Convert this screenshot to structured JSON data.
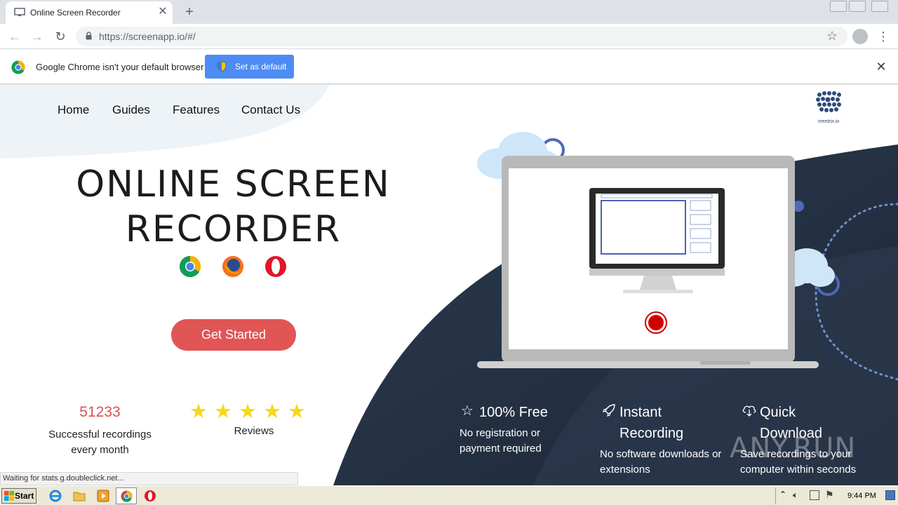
{
  "browser": {
    "tab_title": "Online Screen Recorder",
    "url": "https://screenapp.io/#/",
    "infobar_text": "Google Chrome isn't your default browser",
    "infobar_button": "Set as default"
  },
  "nav": {
    "items": [
      "Home",
      "Guides",
      "Features",
      "Contact Us"
    ],
    "logo_text": "meetrix.io"
  },
  "hero": {
    "title_line1": "ONLINE SCREEN",
    "title_line2": "RECORDER",
    "browsers": [
      "chrome-icon",
      "firefox-icon",
      "opera-icon"
    ],
    "cta": "Get Started"
  },
  "stats": {
    "count": "51233",
    "count_label": "Successful recordings every month",
    "stars": "★★★★★",
    "rating": 5,
    "reviews_label": "Reviews"
  },
  "features": [
    {
      "icon": "star-outline-icon",
      "title": "100% Free",
      "desc": "No registration or payment required"
    },
    {
      "icon": "rocket-icon",
      "title": "Instant Recording",
      "desc": "No software downloads or extensions"
    },
    {
      "icon": "cloud-download-icon",
      "title": "Quick Download",
      "desc": "Save recordings to your computer within seconds"
    }
  ],
  "status_bar": "Waiting for stats.g.doubleclick.net...",
  "watermark": "ANY.RUN",
  "taskbar": {
    "start_label": "Start",
    "clock": "9:44 PM"
  },
  "colors": {
    "cta": "#e15555",
    "dark_panel": "#253246",
    "accent_blue": "#4d8cf5",
    "count_red": "#d9534f",
    "star_yellow": "#f7d81c"
  }
}
